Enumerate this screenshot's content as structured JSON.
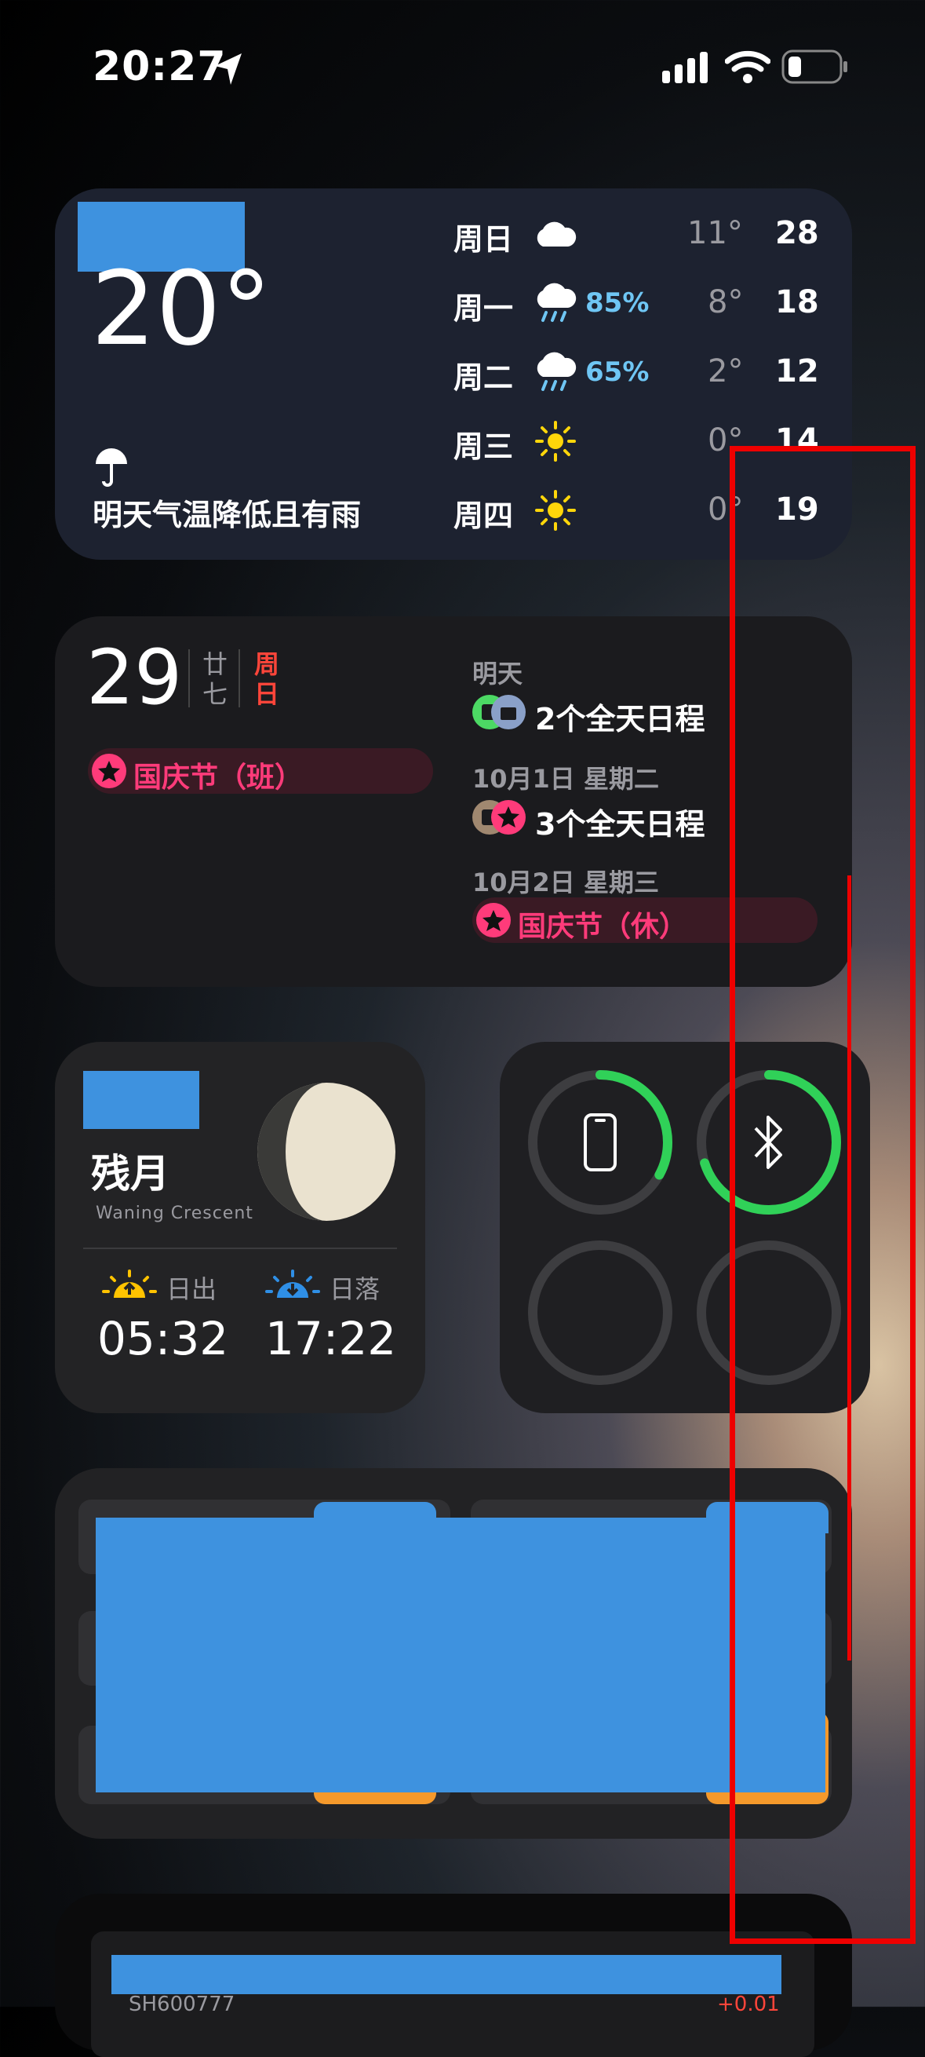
{
  "status": {
    "time": "20:27"
  },
  "weather": {
    "current_temp": "20°",
    "summary": "明天气温降低且有雨",
    "rows": [
      {
        "day": "周日",
        "icon": "cloud-icon",
        "pct": "",
        "lo": "11°",
        "hi": "28"
      },
      {
        "day": "周一",
        "icon": "rain-icon",
        "pct": "85%",
        "lo": "8°",
        "hi": "18"
      },
      {
        "day": "周二",
        "icon": "rain-icon",
        "pct": "65%",
        "lo": "2°",
        "hi": "12"
      },
      {
        "day": "周三",
        "icon": "sun-icon",
        "pct": "",
        "lo": "0°",
        "hi": "14"
      },
      {
        "day": "周四",
        "icon": "sun-icon",
        "pct": "",
        "lo": "0°",
        "hi": "19"
      }
    ]
  },
  "calendar": {
    "date": "29",
    "lunar_top": "廿",
    "lunar_bottom": "七",
    "weekday_top": "周",
    "weekday_bottom": "日",
    "today_event": "国庆节（班）",
    "sections": [
      {
        "header": "明天",
        "event": "2个全天日程"
      },
      {
        "header": "10月1日 星期二",
        "event": "3个全天日程"
      },
      {
        "header": "10月2日 星期三",
        "event": "国庆节（休）"
      }
    ]
  },
  "moon": {
    "phase_cn": "残月",
    "phase_en": "Waning Crescent",
    "sunrise_label": "日出",
    "sunrise": "05:32",
    "sunset_label": "日落",
    "sunset": "17:22"
  },
  "battery": {
    "phone_level": 0.33,
    "bluetooth_level": 0.7
  },
  "stocks": {
    "code": "SH600777",
    "change": "+0.01"
  },
  "colors": {
    "green": "#30d158",
    "orange": "#f5992b",
    "pink": "#ff3b7a",
    "blue_redaction": "#3e92df",
    "red_annotation": "#e00000"
  }
}
